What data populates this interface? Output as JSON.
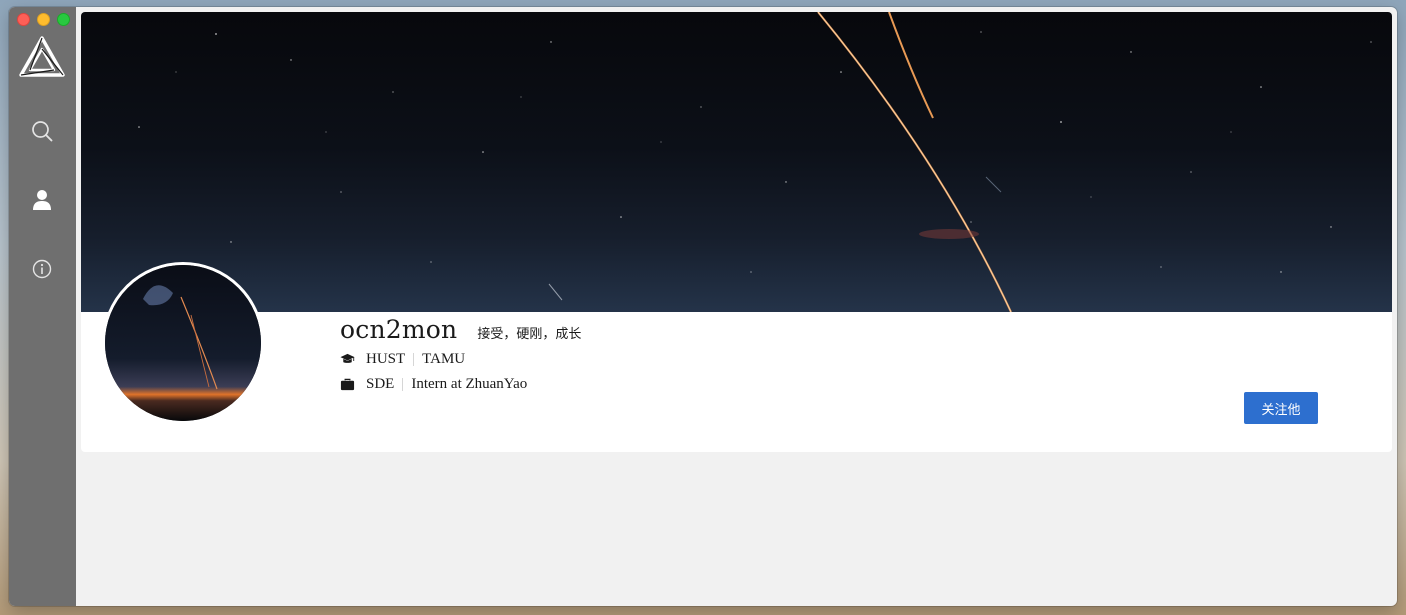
{
  "profile": {
    "username": "ocn2mon",
    "bio": "接受，硬刚，成长",
    "education": [
      "HUST",
      "TAMU"
    ],
    "work": [
      "SDE",
      "Intern at ZhuanYao"
    ],
    "follow_label": "关注他"
  },
  "sidebar": {
    "items": [
      "search-icon",
      "user-icon",
      "info-icon"
    ]
  },
  "colors": {
    "sidebar_bg": "#6f6f6f",
    "follow_button": "#2d6fcf",
    "page_bg": "#f1f1f1"
  }
}
